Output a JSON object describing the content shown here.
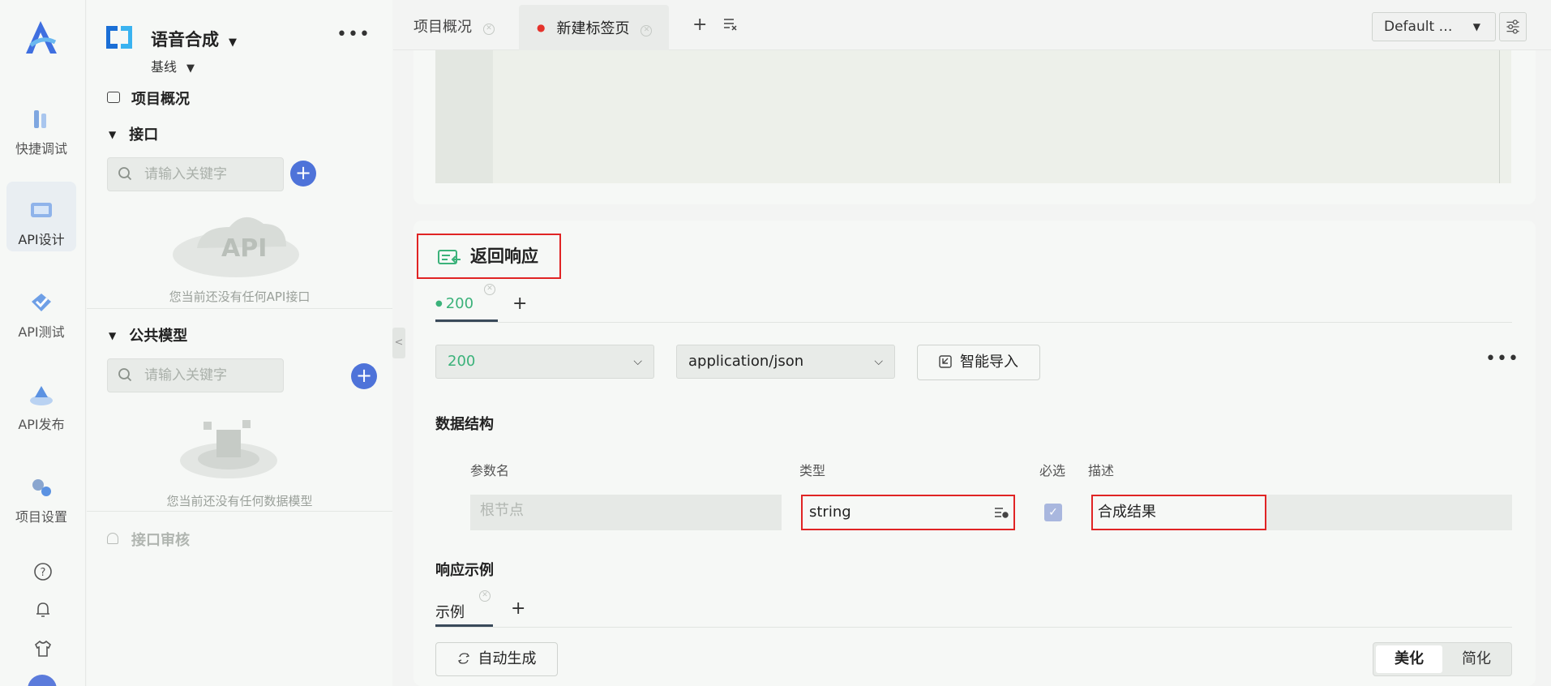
{
  "rail": {
    "items": [
      {
        "label": "快捷调试",
        "icon": "quick-debug-icon"
      },
      {
        "label": "API设计",
        "icon": "api-design-icon"
      },
      {
        "label": "API测试",
        "icon": "api-test-icon"
      },
      {
        "label": "API发布",
        "icon": "api-publish-icon"
      },
      {
        "label": "项目设置",
        "icon": "project-settings-icon"
      }
    ],
    "active": "API设计"
  },
  "sidebar": {
    "project_name": "语音合成",
    "branch": "基线",
    "overview": "项目概况",
    "api_section": {
      "title": "接口",
      "search_placeholder": "请输入关键字",
      "empty_text": "您当前还没有任何API接口"
    },
    "model_section": {
      "title": "公共模型",
      "search_placeholder": "请输入关键字",
      "empty_text": "您当前还没有任何数据模型"
    },
    "audit": "接口审核"
  },
  "tabs": [
    {
      "label": "项目概况",
      "active": false
    },
    {
      "label": "新建标签页",
      "active": true,
      "unsaved": true
    }
  ],
  "environment": {
    "selected": "Default …"
  },
  "response": {
    "title": "返回响应",
    "status_tab": "200",
    "status_select": "200",
    "content_type": "application/json",
    "smart_import": "智能导入",
    "data_structure_label": "数据结构",
    "columns": {
      "name": "参数名",
      "type": "类型",
      "required": "必选",
      "desc": "描述"
    },
    "root_row": {
      "name_placeholder": "根节点",
      "type": "string",
      "required": true,
      "desc": "合成结果"
    },
    "example_label": "响应示例",
    "example_tab": "示例",
    "auto_generate": "自动生成",
    "format_toggle": {
      "beautify": "美化",
      "simplify": "简化",
      "active": "美化"
    }
  },
  "colors": {
    "accent": "#4e73d9",
    "success": "#3bb27a",
    "highlight": "#e02424",
    "unsaved_dot": "#e5322b"
  }
}
